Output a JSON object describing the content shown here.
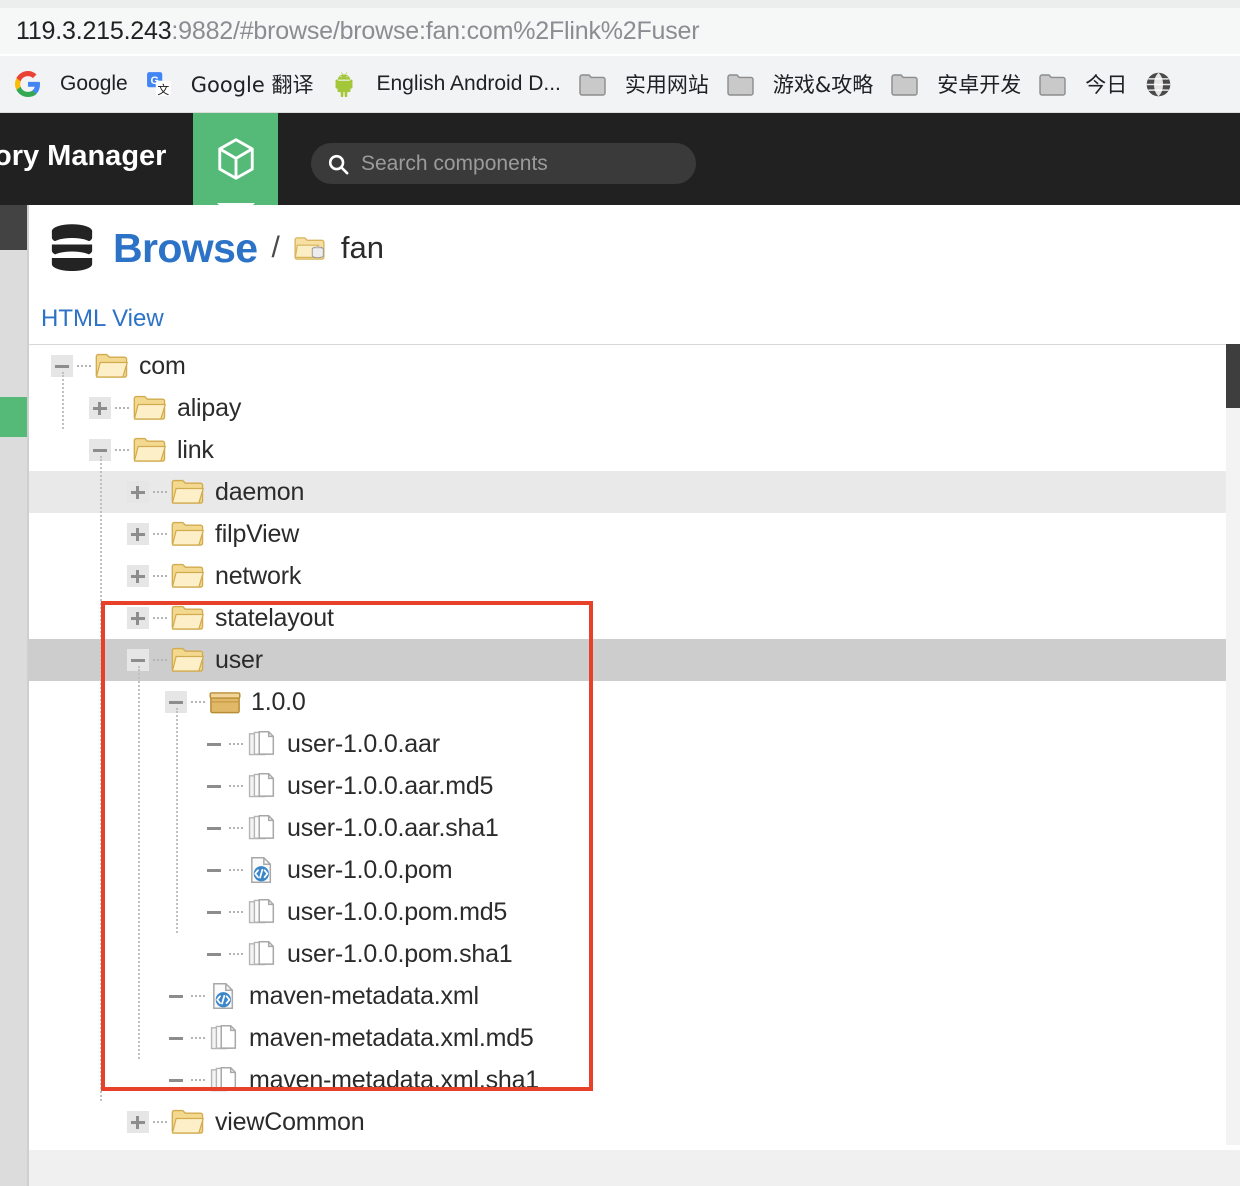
{
  "browser": {
    "url_host": "119.3.215.243",
    "url_rest": ":9882/#browse/browse:fan:com%2Flink%2Fuser",
    "bookmarks": [
      {
        "label": "Google",
        "icon": "google-icon"
      },
      {
        "label": "Google 翻译",
        "icon": "google-translate-icon"
      },
      {
        "label": "English Android D...",
        "icon": "android-icon"
      },
      {
        "label": "实用网站",
        "icon": "folder-icon"
      },
      {
        "label": "游戏&攻略",
        "icon": "folder-icon"
      },
      {
        "label": "安卓开发",
        "icon": "folder-icon"
      },
      {
        "label": "今日",
        "icon": "folder-icon"
      },
      {
        "label": "",
        "icon": "globe-icon"
      }
    ]
  },
  "appbar": {
    "title": "ory Manager",
    "tab_icon": "cube-icon",
    "search_placeholder": "Search components",
    "search_value": "",
    "search_icon": "search-icon",
    "accent_green": "#55b978",
    "bar_bg": "#212121"
  },
  "page": {
    "db_icon": "database-icon",
    "title": "Browse",
    "separator": "/",
    "repo_icon": "repository-folder-icon",
    "repo_name": "fan",
    "html_view_link": "HTML View",
    "title_color": "#2c72c7"
  },
  "tree": {
    "highlight_light": "#e9e9e9",
    "highlight_dark": "#cdcdcd",
    "annotation_color": "#e8412a",
    "rows": [
      {
        "label": "com",
        "depth": 0,
        "expander": "minus",
        "icon": "folder-open-icon",
        "highlight": "none"
      },
      {
        "label": "alipay",
        "depth": 1,
        "expander": "plus",
        "icon": "folder-open-icon",
        "highlight": "none"
      },
      {
        "label": "link",
        "depth": 1,
        "expander": "minus",
        "icon": "folder-open-icon",
        "highlight": "none"
      },
      {
        "label": "daemon",
        "depth": 2,
        "expander": "plus",
        "icon": "folder-open-icon",
        "highlight": "light"
      },
      {
        "label": "filpView",
        "depth": 2,
        "expander": "plus",
        "icon": "folder-open-icon",
        "highlight": "none"
      },
      {
        "label": "network",
        "depth": 2,
        "expander": "plus",
        "icon": "folder-open-icon",
        "highlight": "none"
      },
      {
        "label": "statelayout",
        "depth": 2,
        "expander": "plus",
        "icon": "folder-open-icon",
        "highlight": "none"
      },
      {
        "label": "user",
        "depth": 2,
        "expander": "minus",
        "icon": "folder-open-icon",
        "highlight": "dark"
      },
      {
        "label": "1.0.0",
        "depth": 3,
        "expander": "minus",
        "icon": "package-box-icon",
        "highlight": "none"
      },
      {
        "label": "user-1.0.0.aar",
        "depth": 4,
        "expander": "none",
        "icon": "file-stack-icon",
        "highlight": "none"
      },
      {
        "label": "user-1.0.0.aar.md5",
        "depth": 4,
        "expander": "none",
        "icon": "file-stack-icon",
        "highlight": "none"
      },
      {
        "label": "user-1.0.0.aar.sha1",
        "depth": 4,
        "expander": "none",
        "icon": "file-stack-icon",
        "highlight": "none"
      },
      {
        "label": "user-1.0.0.pom",
        "depth": 4,
        "expander": "none",
        "icon": "xml-file-icon",
        "highlight": "none"
      },
      {
        "label": "user-1.0.0.pom.md5",
        "depth": 4,
        "expander": "none",
        "icon": "file-stack-icon",
        "highlight": "none"
      },
      {
        "label": "user-1.0.0.pom.sha1",
        "depth": 4,
        "expander": "none",
        "icon": "file-stack-icon",
        "highlight": "none"
      },
      {
        "label": "maven-metadata.xml",
        "depth": 3,
        "expander": "none",
        "icon": "xml-file-icon",
        "highlight": "none"
      },
      {
        "label": "maven-metadata.xml.md5",
        "depth": 3,
        "expander": "none",
        "icon": "file-stack-icon",
        "highlight": "none"
      },
      {
        "label": "maven-metadata.xml.sha1",
        "depth": 3,
        "expander": "none",
        "icon": "file-stack-icon",
        "highlight": "none"
      },
      {
        "label": "viewCommon",
        "depth": 2,
        "expander": "plus",
        "icon": "folder-open-icon",
        "highlight": "none"
      }
    ]
  }
}
